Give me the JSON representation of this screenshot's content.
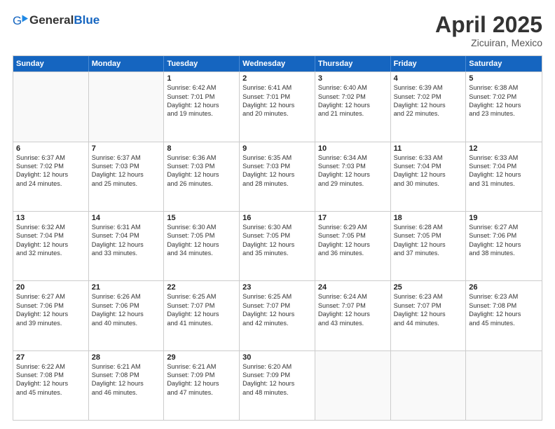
{
  "header": {
    "logo": {
      "text_general": "General",
      "text_blue": "Blue"
    },
    "title": "April 2025",
    "location": "Zicuiran, Mexico"
  },
  "calendar": {
    "days_of_week": [
      "Sunday",
      "Monday",
      "Tuesday",
      "Wednesday",
      "Thursday",
      "Friday",
      "Saturday"
    ],
    "rows": [
      [
        {
          "day": "",
          "lines": []
        },
        {
          "day": "",
          "lines": []
        },
        {
          "day": "1",
          "lines": [
            "Sunrise: 6:42 AM",
            "Sunset: 7:01 PM",
            "Daylight: 12 hours",
            "and 19 minutes."
          ]
        },
        {
          "day": "2",
          "lines": [
            "Sunrise: 6:41 AM",
            "Sunset: 7:01 PM",
            "Daylight: 12 hours",
            "and 20 minutes."
          ]
        },
        {
          "day": "3",
          "lines": [
            "Sunrise: 6:40 AM",
            "Sunset: 7:02 PM",
            "Daylight: 12 hours",
            "and 21 minutes."
          ]
        },
        {
          "day": "4",
          "lines": [
            "Sunrise: 6:39 AM",
            "Sunset: 7:02 PM",
            "Daylight: 12 hours",
            "and 22 minutes."
          ]
        },
        {
          "day": "5",
          "lines": [
            "Sunrise: 6:38 AM",
            "Sunset: 7:02 PM",
            "Daylight: 12 hours",
            "and 23 minutes."
          ]
        }
      ],
      [
        {
          "day": "6",
          "lines": [
            "Sunrise: 6:37 AM",
            "Sunset: 7:02 PM",
            "Daylight: 12 hours",
            "and 24 minutes."
          ]
        },
        {
          "day": "7",
          "lines": [
            "Sunrise: 6:37 AM",
            "Sunset: 7:03 PM",
            "Daylight: 12 hours",
            "and 25 minutes."
          ]
        },
        {
          "day": "8",
          "lines": [
            "Sunrise: 6:36 AM",
            "Sunset: 7:03 PM",
            "Daylight: 12 hours",
            "and 26 minutes."
          ]
        },
        {
          "day": "9",
          "lines": [
            "Sunrise: 6:35 AM",
            "Sunset: 7:03 PM",
            "Daylight: 12 hours",
            "and 28 minutes."
          ]
        },
        {
          "day": "10",
          "lines": [
            "Sunrise: 6:34 AM",
            "Sunset: 7:03 PM",
            "Daylight: 12 hours",
            "and 29 minutes."
          ]
        },
        {
          "day": "11",
          "lines": [
            "Sunrise: 6:33 AM",
            "Sunset: 7:04 PM",
            "Daylight: 12 hours",
            "and 30 minutes."
          ]
        },
        {
          "day": "12",
          "lines": [
            "Sunrise: 6:33 AM",
            "Sunset: 7:04 PM",
            "Daylight: 12 hours",
            "and 31 minutes."
          ]
        }
      ],
      [
        {
          "day": "13",
          "lines": [
            "Sunrise: 6:32 AM",
            "Sunset: 7:04 PM",
            "Daylight: 12 hours",
            "and 32 minutes."
          ]
        },
        {
          "day": "14",
          "lines": [
            "Sunrise: 6:31 AM",
            "Sunset: 7:04 PM",
            "Daylight: 12 hours",
            "and 33 minutes."
          ]
        },
        {
          "day": "15",
          "lines": [
            "Sunrise: 6:30 AM",
            "Sunset: 7:05 PM",
            "Daylight: 12 hours",
            "and 34 minutes."
          ]
        },
        {
          "day": "16",
          "lines": [
            "Sunrise: 6:30 AM",
            "Sunset: 7:05 PM",
            "Daylight: 12 hours",
            "and 35 minutes."
          ]
        },
        {
          "day": "17",
          "lines": [
            "Sunrise: 6:29 AM",
            "Sunset: 7:05 PM",
            "Daylight: 12 hours",
            "and 36 minutes."
          ]
        },
        {
          "day": "18",
          "lines": [
            "Sunrise: 6:28 AM",
            "Sunset: 7:05 PM",
            "Daylight: 12 hours",
            "and 37 minutes."
          ]
        },
        {
          "day": "19",
          "lines": [
            "Sunrise: 6:27 AM",
            "Sunset: 7:06 PM",
            "Daylight: 12 hours",
            "and 38 minutes."
          ]
        }
      ],
      [
        {
          "day": "20",
          "lines": [
            "Sunrise: 6:27 AM",
            "Sunset: 7:06 PM",
            "Daylight: 12 hours",
            "and 39 minutes."
          ]
        },
        {
          "day": "21",
          "lines": [
            "Sunrise: 6:26 AM",
            "Sunset: 7:06 PM",
            "Daylight: 12 hours",
            "and 40 minutes."
          ]
        },
        {
          "day": "22",
          "lines": [
            "Sunrise: 6:25 AM",
            "Sunset: 7:07 PM",
            "Daylight: 12 hours",
            "and 41 minutes."
          ]
        },
        {
          "day": "23",
          "lines": [
            "Sunrise: 6:25 AM",
            "Sunset: 7:07 PM",
            "Daylight: 12 hours",
            "and 42 minutes."
          ]
        },
        {
          "day": "24",
          "lines": [
            "Sunrise: 6:24 AM",
            "Sunset: 7:07 PM",
            "Daylight: 12 hours",
            "and 43 minutes."
          ]
        },
        {
          "day": "25",
          "lines": [
            "Sunrise: 6:23 AM",
            "Sunset: 7:07 PM",
            "Daylight: 12 hours",
            "and 44 minutes."
          ]
        },
        {
          "day": "26",
          "lines": [
            "Sunrise: 6:23 AM",
            "Sunset: 7:08 PM",
            "Daylight: 12 hours",
            "and 45 minutes."
          ]
        }
      ],
      [
        {
          "day": "27",
          "lines": [
            "Sunrise: 6:22 AM",
            "Sunset: 7:08 PM",
            "Daylight: 12 hours",
            "and 45 minutes."
          ]
        },
        {
          "day": "28",
          "lines": [
            "Sunrise: 6:21 AM",
            "Sunset: 7:08 PM",
            "Daylight: 12 hours",
            "and 46 minutes."
          ]
        },
        {
          "day": "29",
          "lines": [
            "Sunrise: 6:21 AM",
            "Sunset: 7:09 PM",
            "Daylight: 12 hours",
            "and 47 minutes."
          ]
        },
        {
          "day": "30",
          "lines": [
            "Sunrise: 6:20 AM",
            "Sunset: 7:09 PM",
            "Daylight: 12 hours",
            "and 48 minutes."
          ]
        },
        {
          "day": "",
          "lines": []
        },
        {
          "day": "",
          "lines": []
        },
        {
          "day": "",
          "lines": []
        }
      ]
    ]
  }
}
